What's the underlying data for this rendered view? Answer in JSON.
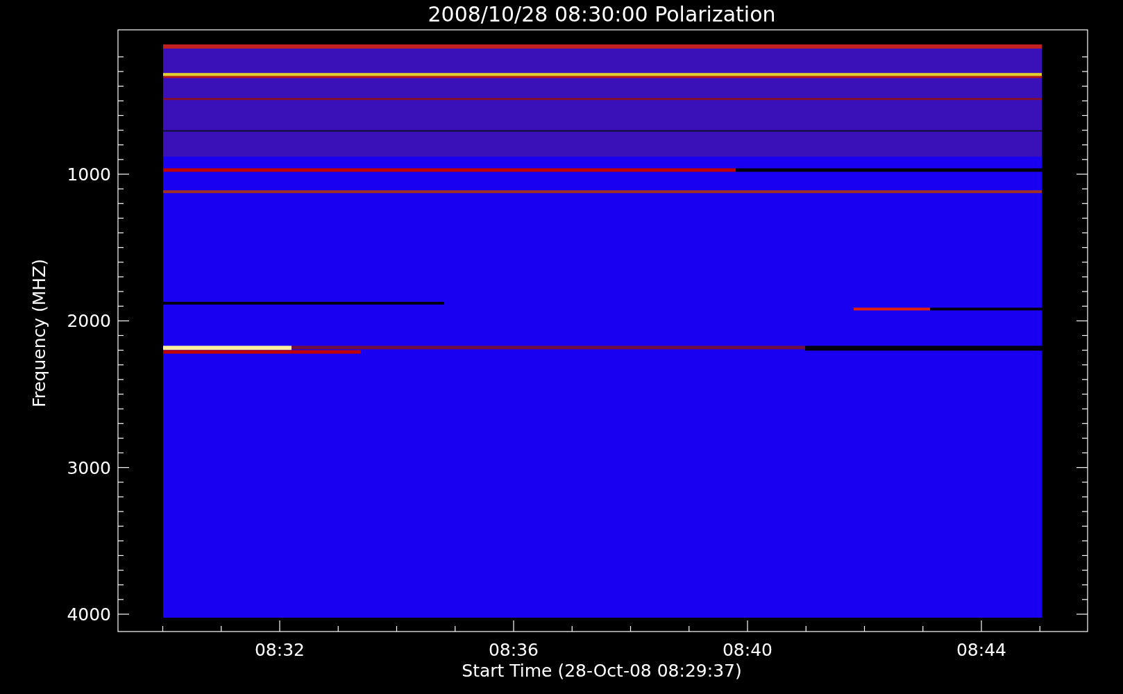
{
  "title": "2008/10/28 08:30:00 Polarization",
  "y_axis": {
    "label": "Frequency (MHZ)",
    "ticks": [
      "1000",
      "2000",
      "3000",
      "4000"
    ]
  },
  "x_axis": {
    "label": "Start Time (28-Oct-08 08:29:37)",
    "ticks": [
      "08:32",
      "08:36",
      "08:40",
      "08:44"
    ]
  }
}
